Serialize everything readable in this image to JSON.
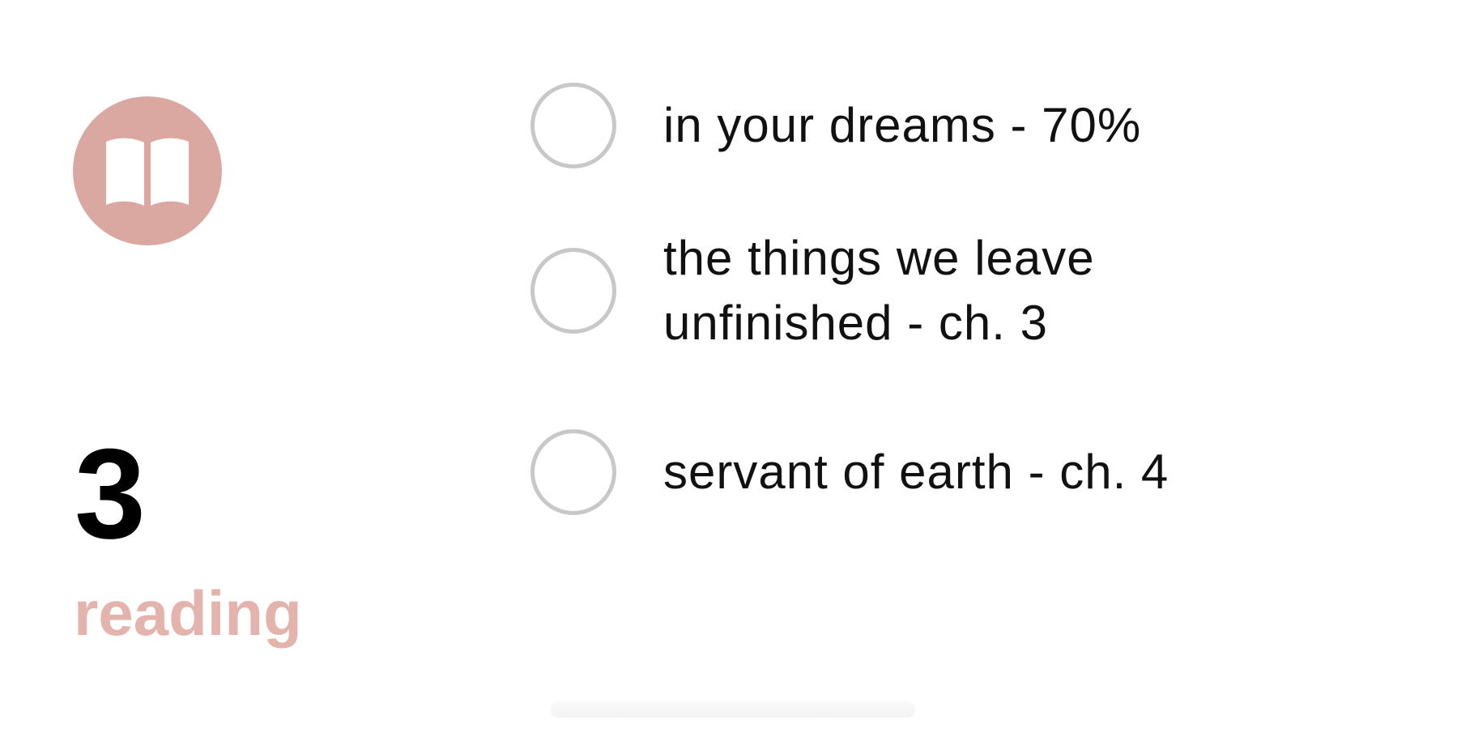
{
  "widget": {
    "accent_color": "#dba8a1",
    "label_color": "#e4b3ac",
    "icon": "open-book-icon",
    "count": "3",
    "caption": "reading"
  },
  "tasks": [
    {
      "text": "in your dreams - 70%",
      "checked": false
    },
    {
      "text": "the things we leave\nunfinished - ch. 3",
      "checked": false
    },
    {
      "text": "servant of earth - ch. 4",
      "checked": false
    }
  ]
}
